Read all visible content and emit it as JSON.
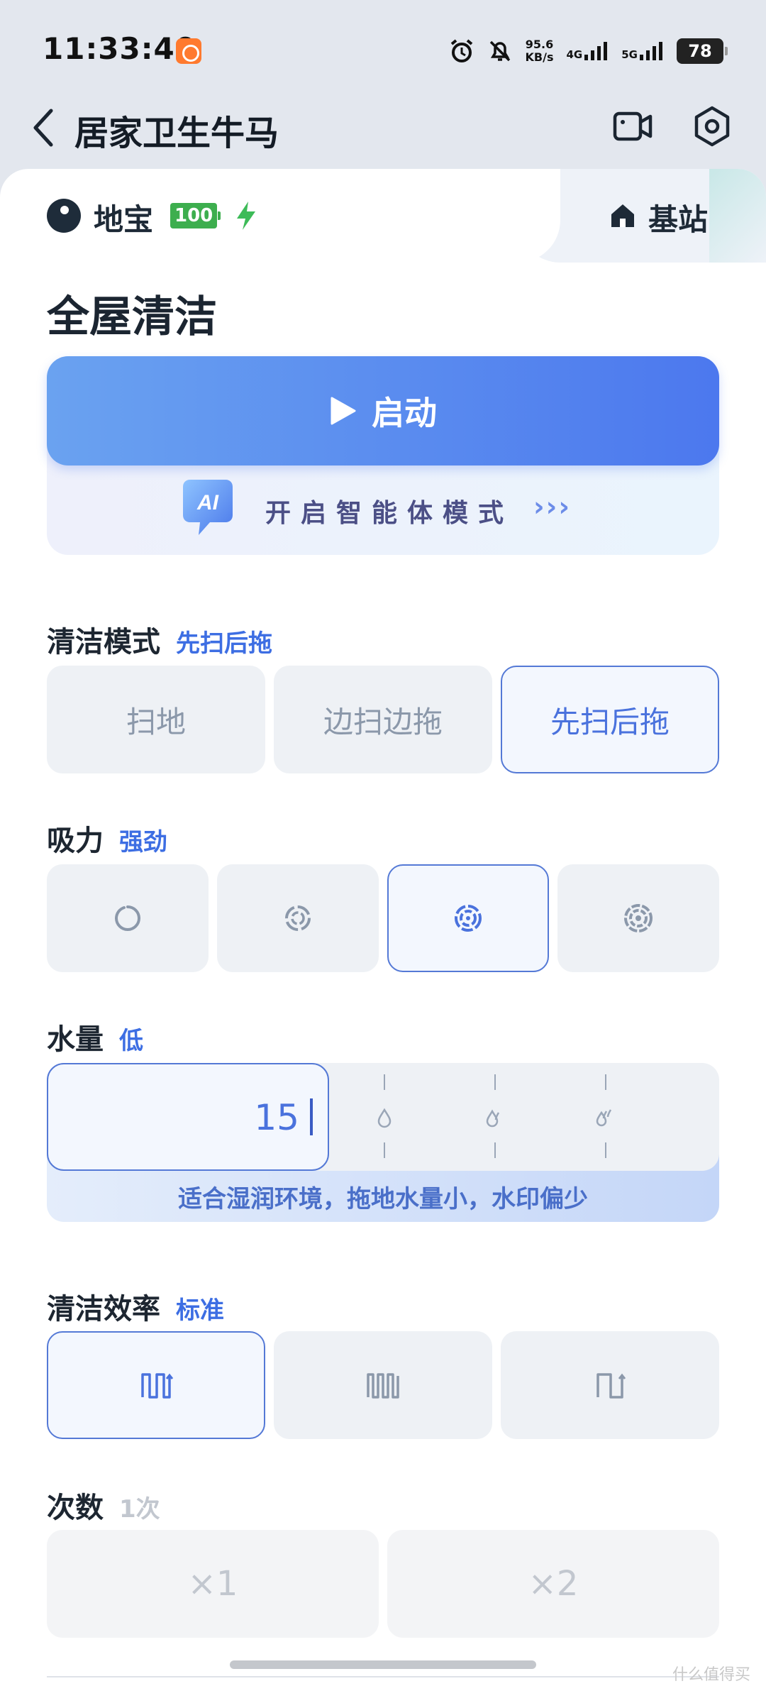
{
  "status_bar": {
    "time": "11:33:40",
    "net_speed_value": "95.6",
    "net_speed_unit": "KB/s",
    "net_tag_1": "4G",
    "net_tag_2": "5G",
    "battery": "78",
    "icons": [
      "alarm-icon",
      "mute-icon",
      "signal-4g-icon",
      "signal-5g-icon"
    ]
  },
  "header": {
    "title": "居家卫生牛马"
  },
  "device": {
    "robot_name": "地宝",
    "battery": "100",
    "base_label": "基站"
  },
  "section_title": "全屋清洁",
  "start": {
    "label": "启动",
    "ai_badge": "AI",
    "ai_label": "开启智能体模式",
    "ai_arrows": "›››"
  },
  "clean_mode": {
    "label": "清洁模式",
    "value": "先扫后拖",
    "options": [
      "扫地",
      "边扫边拖",
      "先扫后拖"
    ],
    "selected_index": 2
  },
  "suction": {
    "label": "吸力",
    "value": "强劲",
    "levels": 4,
    "selected_index": 2
  },
  "water": {
    "label": "水量",
    "value": "低",
    "level": "15",
    "hint": "适合湿润环境，拖地水量小，水印偏少"
  },
  "efficiency": {
    "label": "清洁效率",
    "value": "标准",
    "selected_index": 0
  },
  "count": {
    "label": "次数",
    "value": "1次",
    "options": [
      "×1",
      "×2"
    ]
  },
  "watermark": "什么值得买",
  "colors": {
    "accent": "#4a72dd",
    "start_gradient_start": "#6aa2f0",
    "start_gradient_end": "#4c78ee",
    "battery_green": "#3dae4e"
  }
}
